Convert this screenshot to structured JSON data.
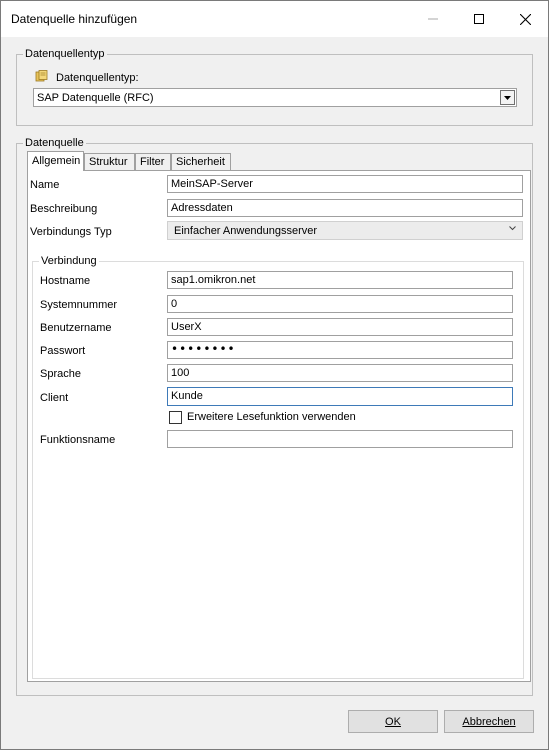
{
  "window": {
    "title": "Datenquelle hinzufügen",
    "controls": [
      "minimize-icon",
      "maximize-icon",
      "close-icon"
    ]
  },
  "source_type_group": {
    "legend": "Datenquellentyp",
    "label": "Datenquellentyp:",
    "icon": "database-icon",
    "selected": "SAP Datenquelle (RFC)"
  },
  "data_source_group": {
    "legend": "Datenquelle",
    "tabs": [
      {
        "label": "Allgemein",
        "active": true
      },
      {
        "label": "Struktur",
        "active": false
      },
      {
        "label": "Filter",
        "active": false
      },
      {
        "label": "Sicherheit",
        "active": false
      }
    ],
    "general": {
      "name_label": "Name",
      "name_value": "MeinSAP-Server",
      "description_label": "Beschreibung",
      "description_value": "Adressdaten",
      "connection_type_label": "Verbindungs Typ",
      "connection_type_value": "Einfacher Anwendungsserver"
    },
    "connection": {
      "legend": "Verbindung",
      "hostname_label": "Hostname",
      "hostname_value": "sap1.omikron.net",
      "system_number_label": "Systemnummer",
      "system_number_value": "0",
      "username_label": "Benutzername",
      "username_value": "UserX",
      "password_label": "Passwort",
      "password_value": "••••••••",
      "language_label": "Sprache",
      "language_value": "100",
      "client_label": "Client",
      "client_value": "Kunde",
      "extended_read_label": "Erweitere Lesefunktion verwenden",
      "extended_read_checked": false,
      "function_name_label": "Funktionsname",
      "function_name_value": ""
    }
  },
  "buttons": {
    "ok_label": "OK",
    "cancel_label": "Abbrechen"
  },
  "colors": {
    "window_bg": "#f0f0f0",
    "focus_border": "#3e7ab8"
  }
}
